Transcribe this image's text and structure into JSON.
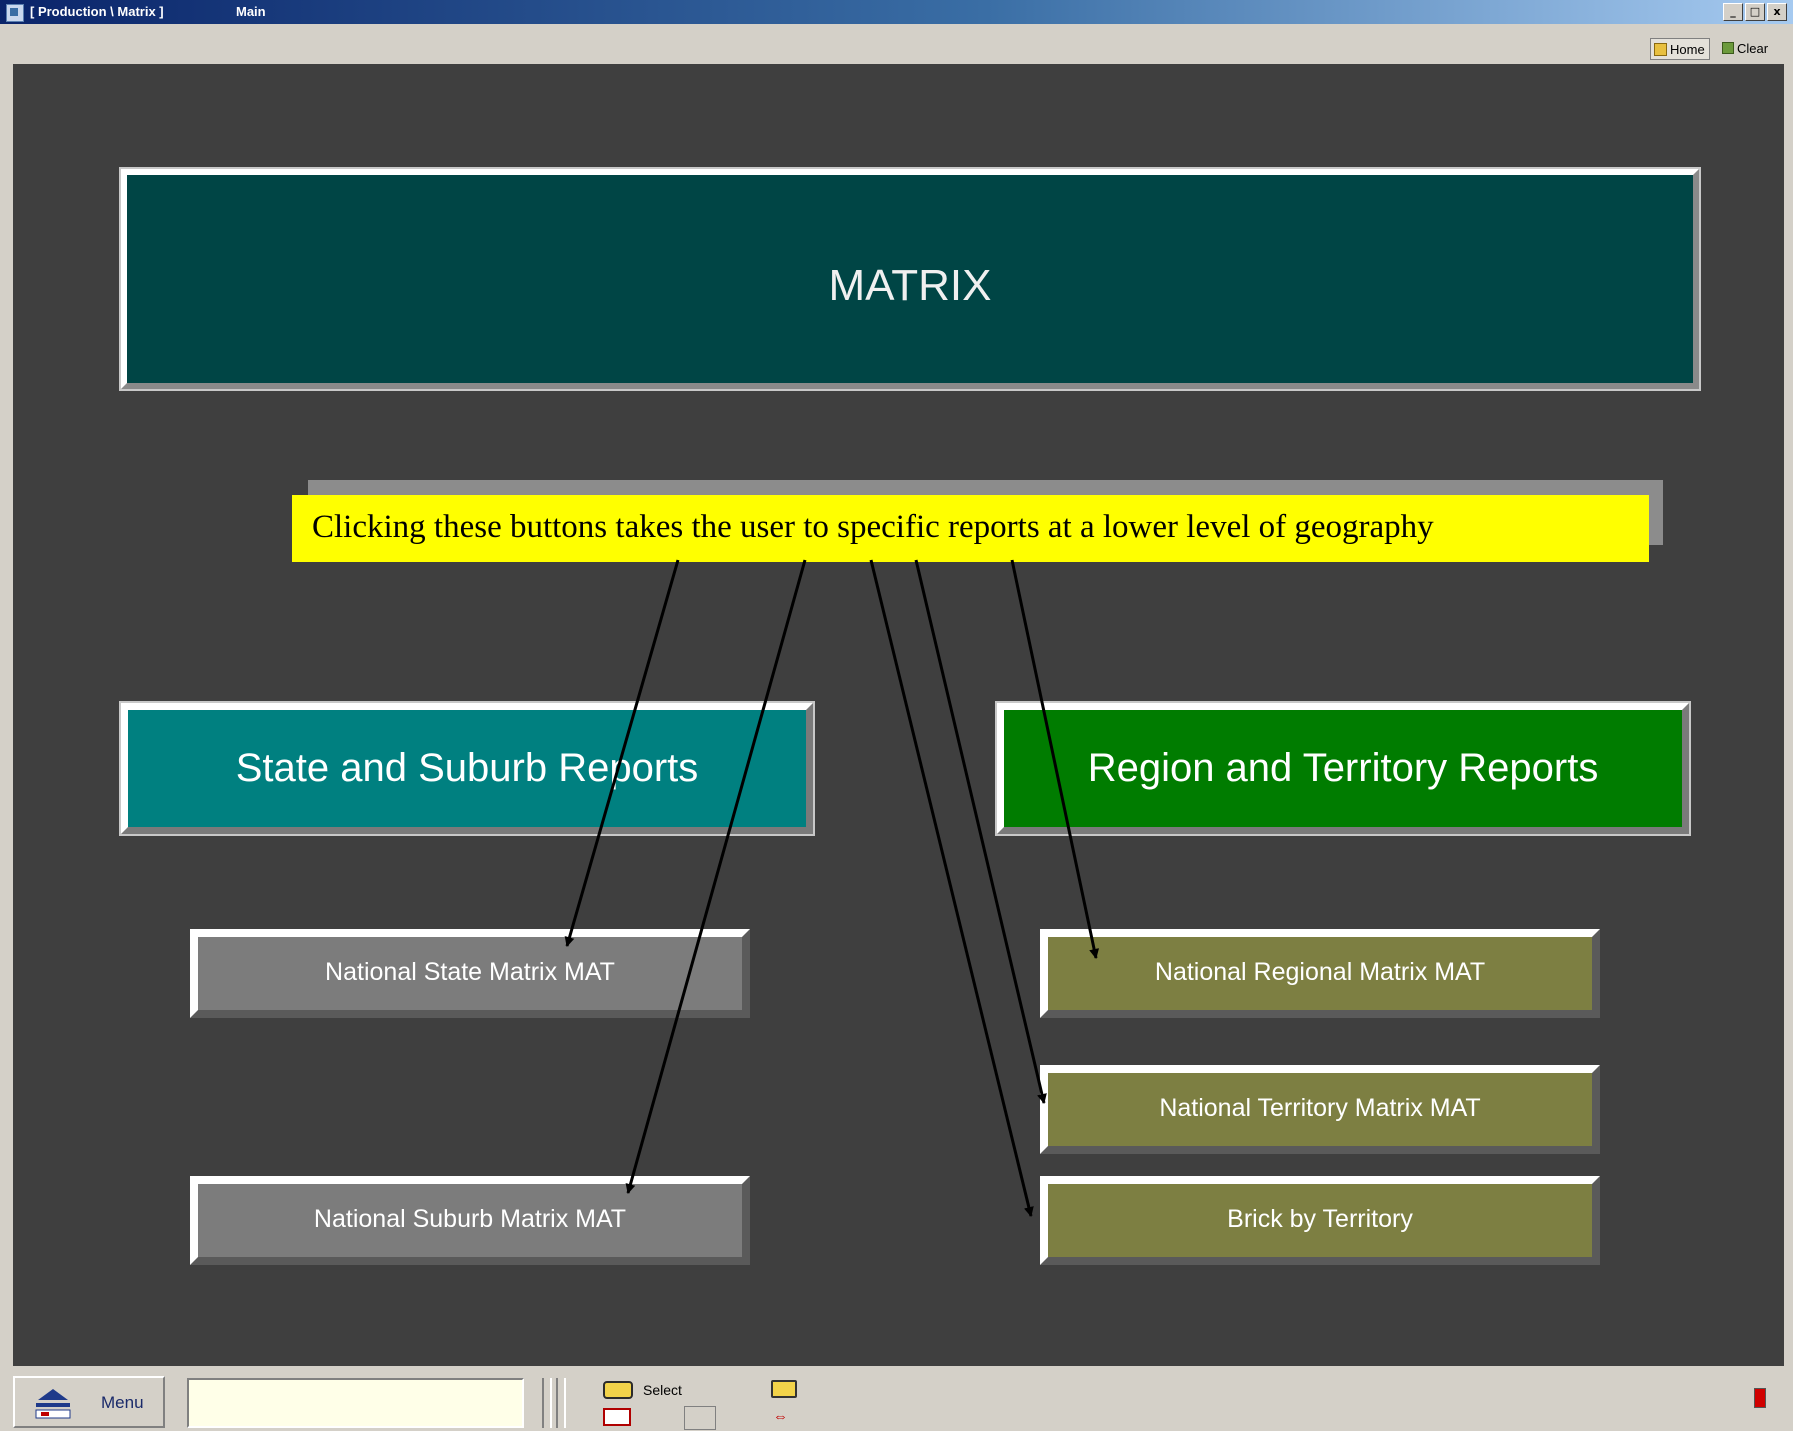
{
  "window": {
    "title": "[ Production \\ Matrix ]",
    "subtitle": "Main",
    "controls": [
      "_",
      "□",
      "x"
    ]
  },
  "toolbar": {
    "home_label": "Home",
    "clear_label": "Clear"
  },
  "header": {
    "title": "MATRIX"
  },
  "callout": {
    "text": "Clicking these buttons takes the user to specific reports at a lower level of geography"
  },
  "sections": {
    "state": "State and Suburb Reports",
    "region": "Region and Territory Reports"
  },
  "buttons": {
    "national_state": "National State Matrix MAT",
    "national_suburb": "National Suburb Matrix MAT",
    "national_regional": "National Regional Matrix MAT",
    "national_territory": "National Territory Matrix MAT",
    "brick_by_territory": "Brick by Territory"
  },
  "bottombar": {
    "menu_label": "Menu",
    "command_value": "",
    "select_label": "Select"
  },
  "colors": {
    "background": "#3f3f3f",
    "header": "#004545",
    "state_section": "#008080",
    "region_section": "#007c00",
    "gray_button": "#7c7c7c",
    "olive_button": "#7d7f42",
    "callout": "#ffff00"
  },
  "icons": [
    "app-icon",
    "home-icon",
    "clear-icon",
    "menu-icon",
    "select-icon",
    "print-icon",
    "swap-icon",
    "status-icon"
  ]
}
